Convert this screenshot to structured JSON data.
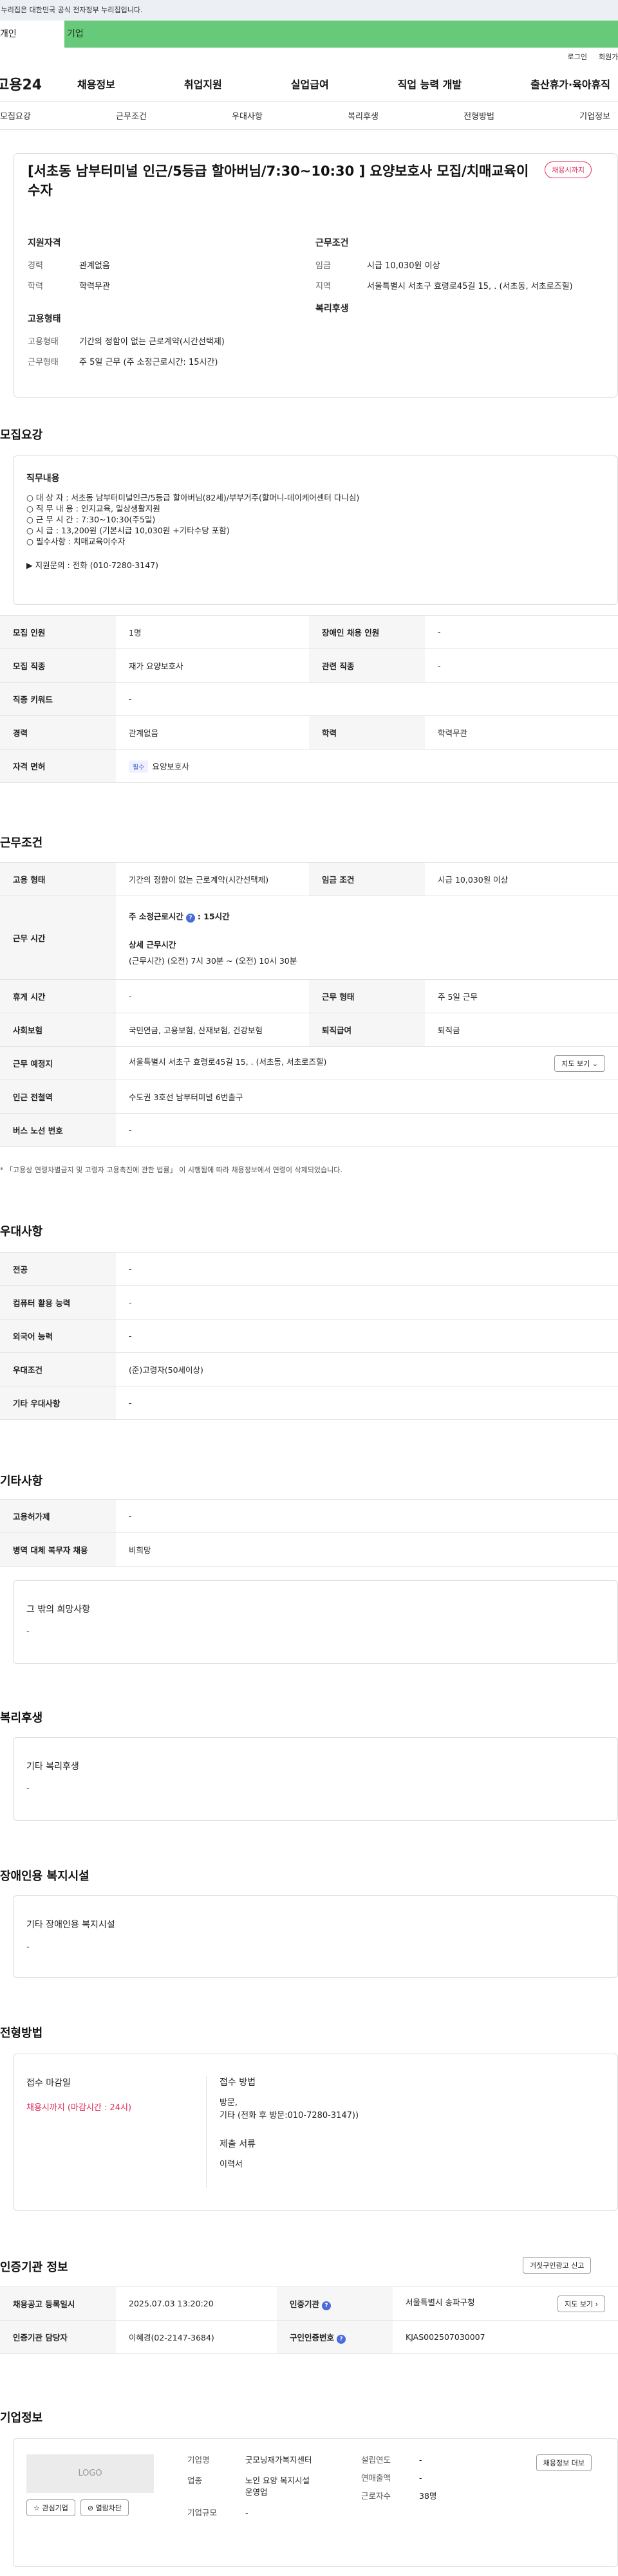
{
  "gov_banner": "이 누리집은 대한민국 공식 전자정부 누리집입니다.",
  "top_tabs": [
    "개인",
    "기업"
  ],
  "util": [
    "로그인",
    "회원가입"
  ],
  "logo": "고용24",
  "menu": [
    "채용정보",
    "취업지원",
    "실업급여",
    "직업 능력 개발",
    "출산휴가·육아휴직"
  ],
  "subtabs": [
    "모집요강",
    "근무조건",
    "우대사항",
    "복리후생",
    "전형방법",
    "기업정보"
  ],
  "job": {
    "title": "[서초동 남부터미널 인근/5등급 할아버님/7:30~10:30 ] 요양보호사 모집/치매교육이수자",
    "badge": "채용시까지",
    "qual_h": "지원자격",
    "cond_h": "근무조건",
    "type_h": "고용형태",
    "welfare_h": "복리후생",
    "career_k": "경력",
    "career_v": "관계없음",
    "edu_k": "학력",
    "edu_v": "학력무관",
    "wage_k": "임금",
    "wage_v": "시급 10,030원 이상",
    "region_k": "지역",
    "region_v": "서울특별시 서초구 효령로45길 15, . (서초동, 서초로즈힐)",
    "emp_k": "고용형태",
    "emp_v": "기간의 정함이 없는 근로계약(시간선택제)",
    "worktype_k": "근무형태",
    "worktype_v": "주 5일 근무 (주 소정근로시간: 15시간)"
  },
  "sec_recruit": "모집요강",
  "duty": {
    "h": "직무내용",
    "lines": [
      "○ 대 상 자 : 서초동 남부터미널인근/5등급 할아버님(82세)/부부거주(할머니-데이케어센터 다니심)",
      "○ 직 무 내 용 : 인지교육, 일상생활지원",
      "○ 근 무 시 간 : 7:30~10:30(주5일)",
      "○ 시 급 : 13,200원 (기본시급 10,030원 +기타수당 포함)",
      "○ 필수사항 : 치매교육이수자"
    ],
    "contact": "▶ 지원문의 : 전화 (010-7280-3147)"
  },
  "recruit_tbl": {
    "r1": [
      "모집 인원",
      "1명",
      "장애인 채용 인원",
      "-"
    ],
    "r2": [
      "모집 직종",
      "재가 요양보호사",
      "관련 직종",
      "-"
    ],
    "r3": [
      "직종 키워드",
      "-"
    ],
    "r4": [
      "경력",
      "관계없음",
      "학력",
      "학력무관"
    ],
    "r5": [
      "자격 면허",
      "필수",
      "요양보호사"
    ]
  },
  "sec_cond": "근무조건",
  "cond_tbl": {
    "emp": [
      "고용 형태",
      "기간의 정함이 없는 근로계약(시간선택제)",
      "임금 조건",
      "시급 10,030원 이상"
    ],
    "time_k": "근무 시간",
    "time_a": "주 소정근로시간",
    "time_b": ": 15시간",
    "time_c": "상세 근무시간",
    "time_d": "(근무시간) (오전) 7시 30분 ~ (오전) 10시 30분",
    "rest": [
      "휴게 시간",
      "-",
      "근무 형태",
      "주 5일 근무"
    ],
    "ins": [
      "사회보험",
      "국민연금, 고용보험, 산재보험, 건강보험",
      "퇴직급여",
      "퇴직금"
    ],
    "place": [
      "근무 예정지",
      "서울특별시 서초구 효령로45길 15, . (서초동, 서초로즈힐)",
      "지도 보기 ⌄"
    ],
    "station": [
      "인근 전철역",
      "수도권 3호선 남부터미널 6번출구"
    ],
    "bus": [
      "버스 노선 번호",
      "-"
    ]
  },
  "note": "* 「고용상 연령차별금지 및 고령자 고용촉진에 관한 법률」 이 시행됨에 따라 채용정보에서 연령이 삭제되었습니다.",
  "sec_pref": "우대사항",
  "pref_tbl": [
    [
      "전공",
      "-"
    ],
    [
      "컴퓨터 활용 능력",
      "-"
    ],
    [
      "외국어 능력",
      "-"
    ],
    [
      "우대조건",
      "(준)고령자(50세이상)"
    ],
    [
      "기타 우대사항",
      "-"
    ]
  ],
  "sec_etc": "기타사항",
  "etc_tbl": [
    [
      "고용허가제",
      "-"
    ],
    [
      "병역 대체 복무자 채용",
      "비희망"
    ]
  ],
  "etc_box": {
    "h": "그 밖의 희망사항",
    "v": "-"
  },
  "sec_welfare": "복리후생",
  "welfare_box": {
    "h": "기타 복리후생",
    "v": "-"
  },
  "sec_disab": "장애인용 복지시설",
  "disab_box": {
    "h": "기타 장애인용 복지시설",
    "v": "-"
  },
  "sec_method": "전형방법",
  "method": {
    "deadline_h": "접수 마감일",
    "deadline_v": "채용시까지 (마감시간 : 24시)",
    "way_h": "접수 방법",
    "way_v1": "방문,",
    "way_v2": "기타 (전화 후 방문:010-7280-3147))",
    "docs_h": "제출 서류",
    "docs_v": "이력서"
  },
  "sec_cert": "인증기관 정보",
  "cert_btn": "거짓구인광고 신고",
  "cert_tbl": {
    "r1": [
      "채용공고 등록일시",
      "2025.07.03 13:20:20",
      "인증기관",
      "서울특별시 송파구청",
      "지도 보기 ›"
    ],
    "r2": [
      "인증기관 담당자",
      "이혜경(02-2147-3684)",
      "구인인증번호",
      "KJAS002507030007"
    ]
  },
  "sec_company": "기업정보",
  "company": {
    "logo": "LOGO",
    "fav": "☆ 관심기업",
    "block": "⊘ 열람차단",
    "name_k": "기업명",
    "name_v": "굿모닝재가복지센터",
    "year_k": "설립연도",
    "year_v": "-",
    "sales_k": "연매출액",
    "sales_v": "-",
    "ind_k": "업종",
    "ind_v": "노인 요양 복지시설 운영업",
    "emp_k": "근로자수",
    "emp_v": "38명",
    "size_k": "기업규모",
    "size_v": "-",
    "btn": "채용정보 더보"
  },
  "colors": {
    "green": "#67c97a",
    "red": "#e0305c",
    "blue": "#4a6bdc"
  }
}
